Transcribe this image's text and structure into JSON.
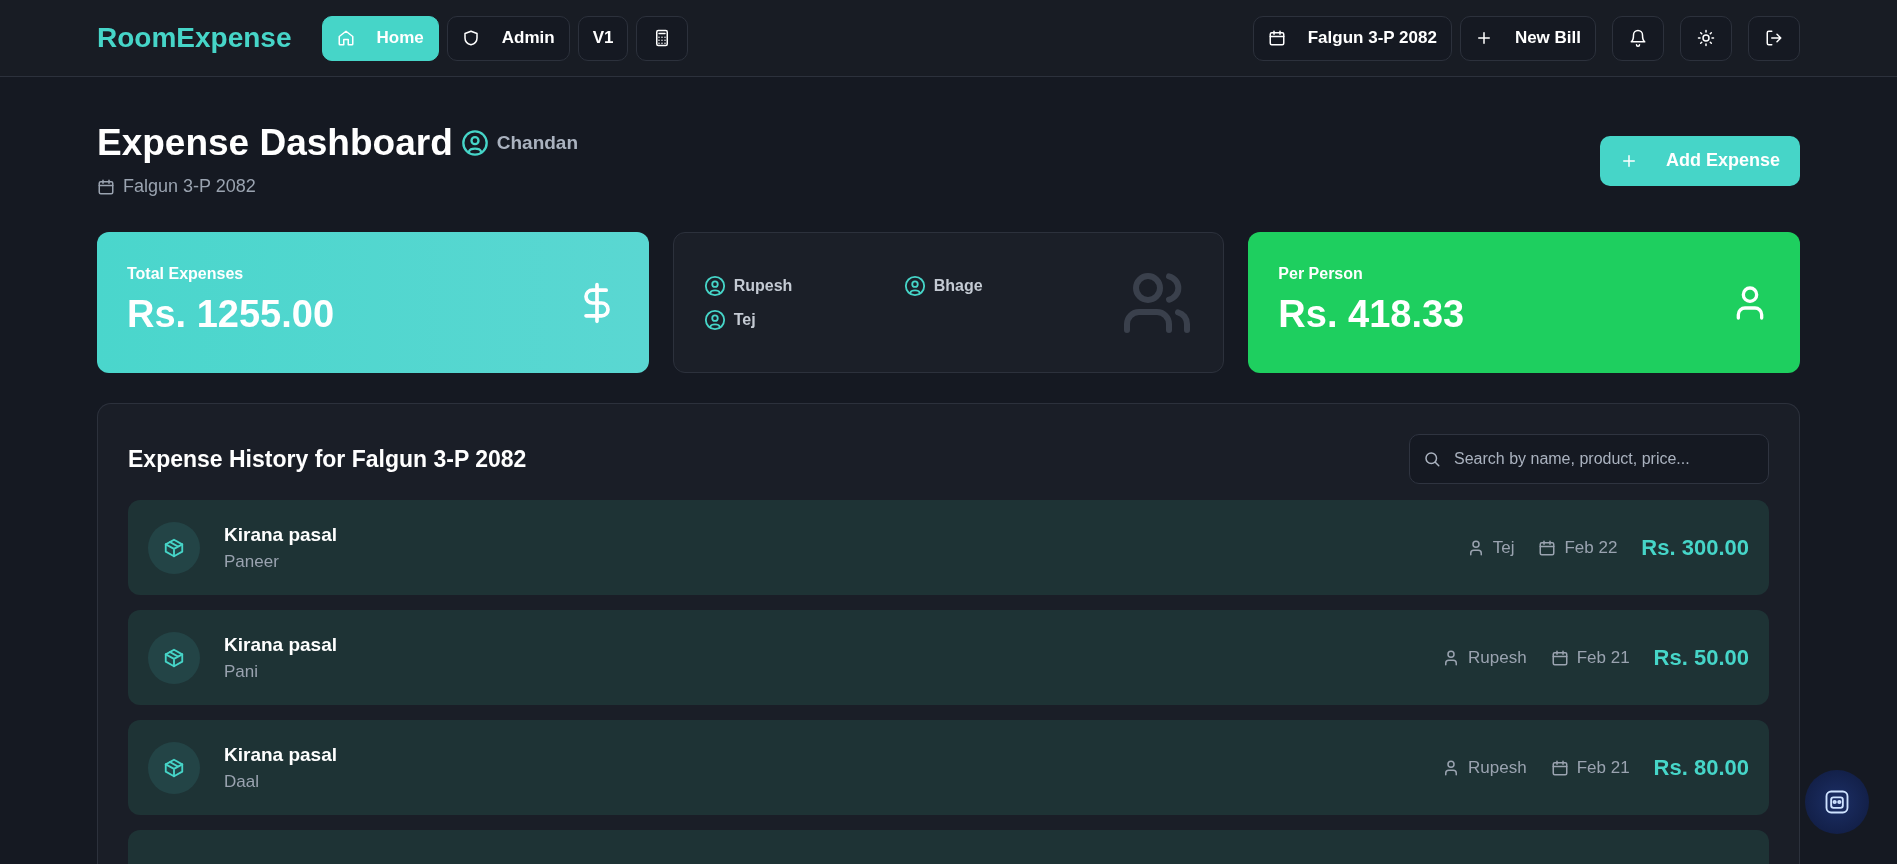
{
  "brand": "RoomExpense",
  "nav": [
    {
      "label": "Home",
      "selected": true
    },
    {
      "label": "Admin",
      "selected": false
    },
    {
      "label": "V1",
      "selected": false
    },
    {
      "selected": false
    }
  ],
  "nav_right": {
    "period": "Falgun 3-P 2082",
    "new_bill": "New Bill"
  },
  "header": {
    "title": "Expense Dashboard",
    "user": "Chandan",
    "period": "Falgun 3-P 2082",
    "add_button": "Add Expense"
  },
  "stats": {
    "total_label": "Total Expenses",
    "total": "Rs. 1255.00",
    "members": [
      "Rupesh",
      "Bhage",
      "Tej"
    ],
    "per_person_label": "Per Person",
    "per_person": "Rs. 418.33"
  },
  "history": {
    "title": "Expense History for Falgun 3-P 2082",
    "search": {
      "placeholder": "Search by name, product, price..."
    },
    "rows": [
      {
        "title": "Kirana pasal",
        "product": "Paneer",
        "person": "Tej",
        "date": "Feb 22",
        "amount": "Rs. 300.00"
      },
      {
        "title": "Kirana pasal",
        "product": "Pani",
        "person": "Rupesh",
        "date": "Feb 21",
        "amount": "Rs. 50.00"
      },
      {
        "title": "Kirana pasal",
        "product": "Daal",
        "person": "Rupesh",
        "date": "Feb 21",
        "amount": "Rs. 80.00"
      }
    ]
  }
}
